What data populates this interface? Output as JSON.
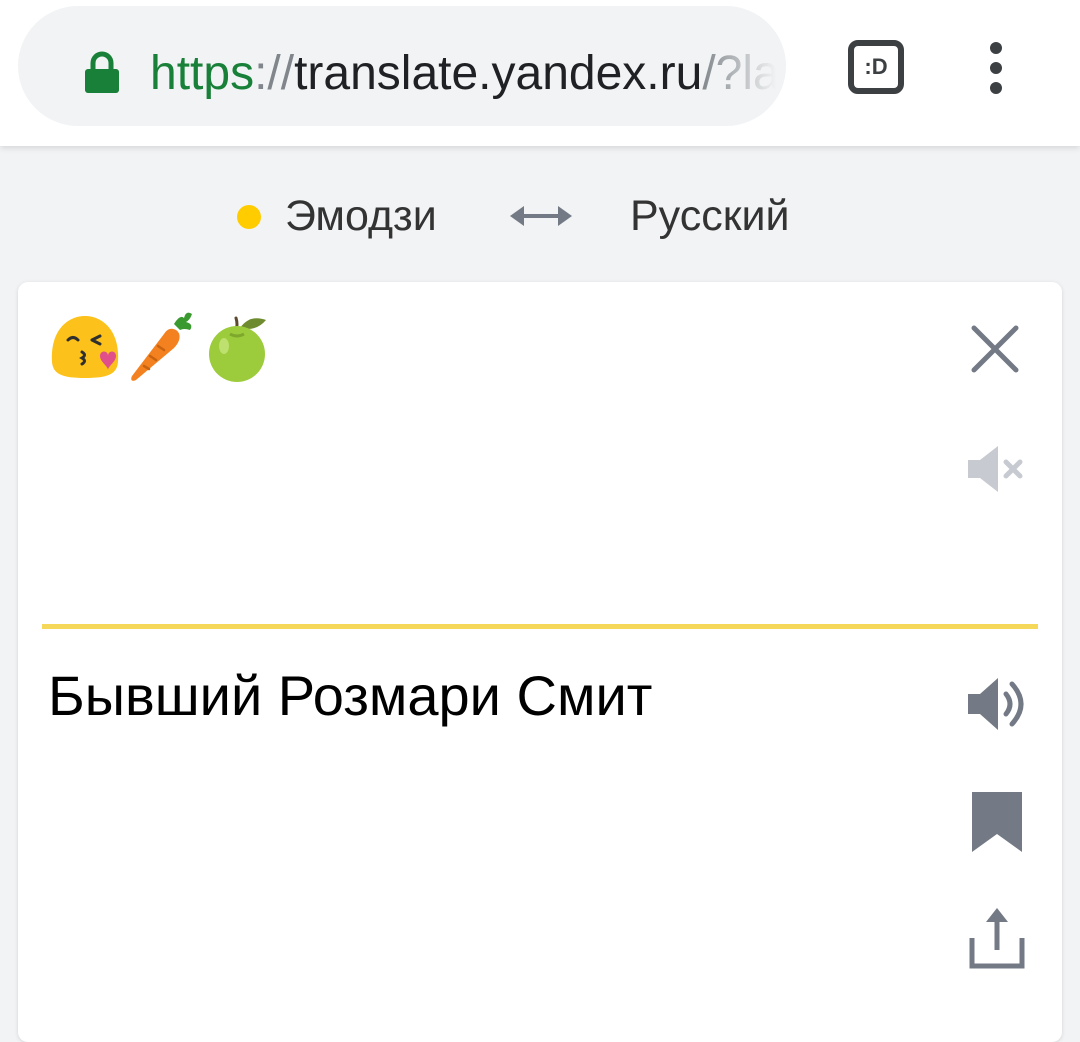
{
  "browser": {
    "url": {
      "scheme": "https",
      "separator": "://",
      "host": "translate.yandex.ru",
      "rest": "/?la"
    },
    "tab_switcher_label": ":D",
    "icons": [
      "lock-icon",
      "tab-switcher-icon",
      "more-vert-icon"
    ]
  },
  "languages": {
    "source": "Эмодзи",
    "target": "Русский",
    "source_dot_color": "#ffcc00",
    "swap_icon": "swap-arrows-icon"
  },
  "source": {
    "emojis": [
      "kissing-face-emoji",
      "carrot-emoji",
      "green-apple-emoji"
    ]
  },
  "translation": {
    "text": "Бывший Розмари Смит"
  },
  "actions": {
    "icons": [
      "clear-icon",
      "mute-icon",
      "speaker-icon",
      "bookmark-icon",
      "share-icon"
    ]
  },
  "colors": {
    "accent_divider": "#f5d85a",
    "icon_gray": "#737a85",
    "icon_light": "#c7cbd1",
    "url_green": "#188038"
  }
}
